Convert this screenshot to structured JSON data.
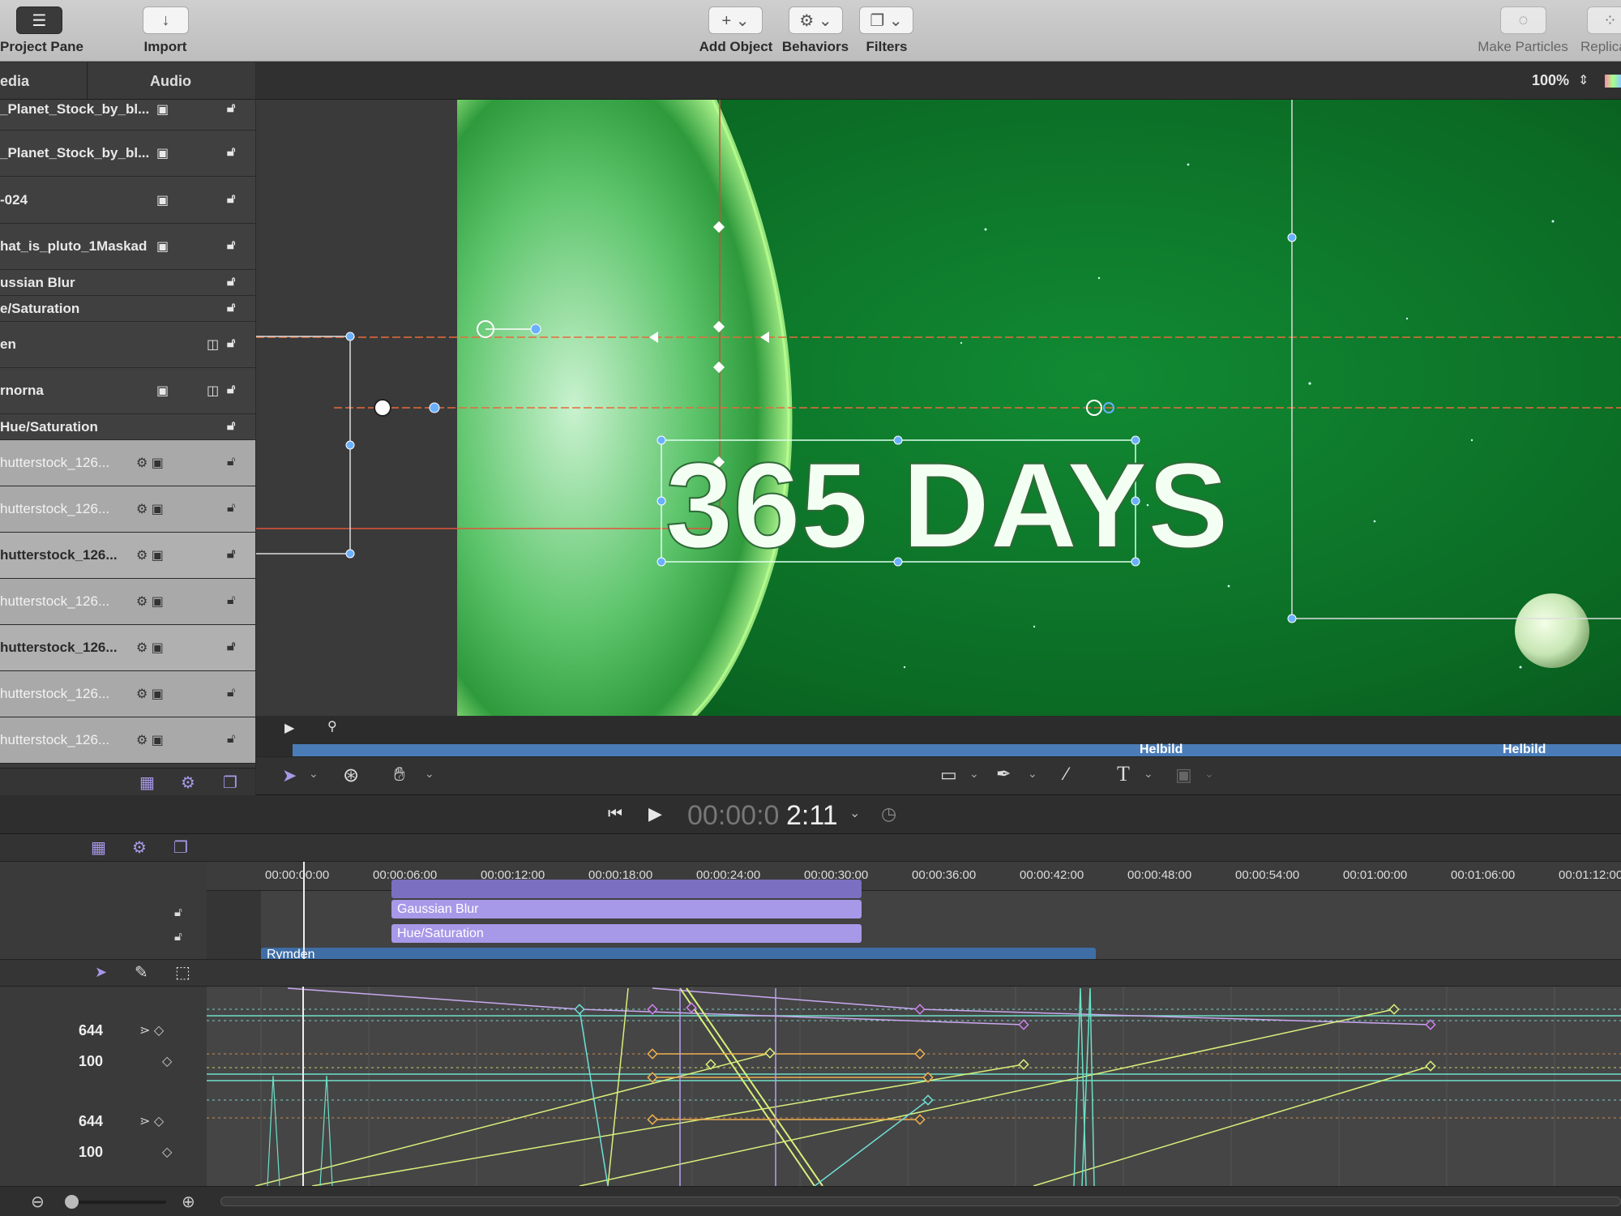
{
  "toolbar": {
    "project_pane": "Project Pane",
    "import": "Import",
    "add_object": "Add Object",
    "behaviors": "Behaviors",
    "filters": "Filters",
    "make_particles": "Make Particles",
    "replicate": "Replica"
  },
  "panel_tabs": {
    "media": "edia",
    "audio": "Audio"
  },
  "zoom": "100%",
  "layers": [
    {
      "name": "_Planet_Stock_by_bl..."
    },
    {
      "name": "_Planet_Stock_by_bl..."
    },
    {
      "name": "-024"
    },
    {
      "name": "hat_is_pluto_1Maskad"
    },
    {
      "name": "ussian Blur"
    },
    {
      "name": "e/Saturation"
    },
    {
      "name": "en"
    },
    {
      "name": "rnorna"
    },
    {
      "name": "Hue/Saturation"
    },
    {
      "name": "hutterstock_126..."
    },
    {
      "name": "hutterstock_126..."
    },
    {
      "name": "hutterstock_126..."
    },
    {
      "name": "hutterstock_126..."
    },
    {
      "name": "hutterstock_126..."
    },
    {
      "name": "hutterstock_126..."
    },
    {
      "name": "hutterstock_126..."
    }
  ],
  "canvas": {
    "title_text": "365 DAYS"
  },
  "mini_timeline": {
    "marker1": "Helbild",
    "marker2": "Helbild"
  },
  "timecode": {
    "dim": "00:00:0",
    "bright": "2:11"
  },
  "ruler": [
    "00:00:00:00",
    "00:00:06:00",
    "00:00:12:00",
    "00:00:18:00",
    "00:00:24:00",
    "00:00:30:00",
    "00:00:36:00",
    "00:00:42:00",
    "00:00:48:00",
    "00:00:54:00",
    "00:01:00:00",
    "00:01:06:00",
    "00:01:12:00"
  ],
  "tracks": {
    "gaussian": "Gaussian Blur",
    "hue": "Hue/Saturation",
    "group": "Rymden"
  },
  "param_values": [
    "644",
    "100",
    "644",
    "100"
  ],
  "colors": {
    "accent": "#a898e8",
    "group_bar": "#3f6ea6",
    "green_bg": "#0f7a2a"
  }
}
